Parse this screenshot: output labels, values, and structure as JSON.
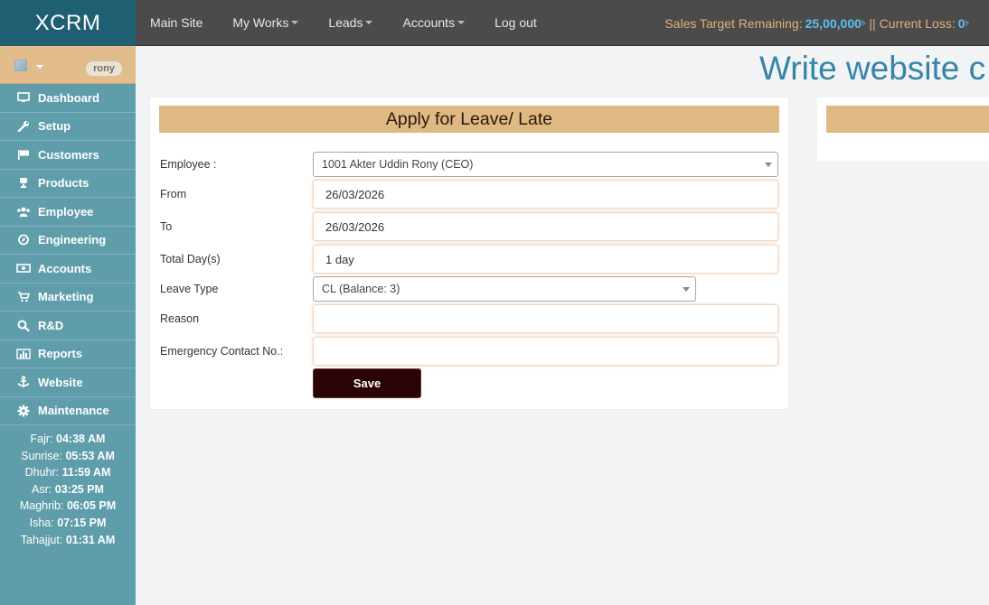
{
  "brand": "XCRM",
  "topnav": {
    "items": [
      {
        "label": "Main Site",
        "dropdown": false
      },
      {
        "label": "My Works",
        "dropdown": true
      },
      {
        "label": "Leads",
        "dropdown": true
      },
      {
        "label": "Accounts",
        "dropdown": true
      },
      {
        "label": "Log out",
        "dropdown": false
      }
    ],
    "sales_label": "Sales Target Remaining:",
    "sales_value": "25,00,000",
    "currency": "৳",
    "separator": "||",
    "loss_label": "Current Loss:",
    "loss_value": "0"
  },
  "user": {
    "badge": "rony"
  },
  "sidebar": {
    "items": [
      {
        "label": "Dashboard",
        "icon": "monitor-icon"
      },
      {
        "label": "Setup",
        "icon": "wrench-icon"
      },
      {
        "label": "Customers",
        "icon": "flag-icon"
      },
      {
        "label": "Products",
        "icon": "trophy-icon"
      },
      {
        "label": "Employee",
        "icon": "users-icon"
      },
      {
        "label": "Engineering",
        "icon": "compass-icon"
      },
      {
        "label": "Accounts",
        "icon": "money-icon"
      },
      {
        "label": "Marketing",
        "icon": "cart-icon"
      },
      {
        "label": "R&D",
        "icon": "search-icon"
      },
      {
        "label": "Reports",
        "icon": "bar-chart-icon"
      },
      {
        "label": "Website",
        "icon": "anchor-icon"
      },
      {
        "label": "Maintenance",
        "icon": "gear-icon"
      }
    ]
  },
  "prayer": [
    {
      "name": "Fajr",
      "time": "04:38 AM"
    },
    {
      "name": "Sunrise",
      "time": "05:53 AM"
    },
    {
      "name": "Dhuhr",
      "time": "11:59 AM"
    },
    {
      "name": "Asr",
      "time": "03:25 PM"
    },
    {
      "name": "Maghrib",
      "time": "06:05 PM"
    },
    {
      "name": "Isha",
      "time": "07:15 PM"
    },
    {
      "name": "Tahajjut",
      "time": "01:31 AM"
    }
  ],
  "page_title": "Write website c",
  "form": {
    "header": "Apply for Leave/ Late",
    "employee_label": "Employee :",
    "employee_value": "1001 Akter Uddin Rony (CEO)",
    "from_label": "From",
    "from_value": "26/03/2026",
    "to_label": "To",
    "to_value": "26/03/2026",
    "total_label": "Total Day(s)",
    "total_value": "1 day",
    "leave_type_label": "Leave Type",
    "leave_type_value": "CL (Balance: 3)",
    "reason_label": "Reason",
    "reason_value": "",
    "emergency_label": "Emergency Contact No.:",
    "emergency_value": "",
    "save_label": "Save"
  }
}
